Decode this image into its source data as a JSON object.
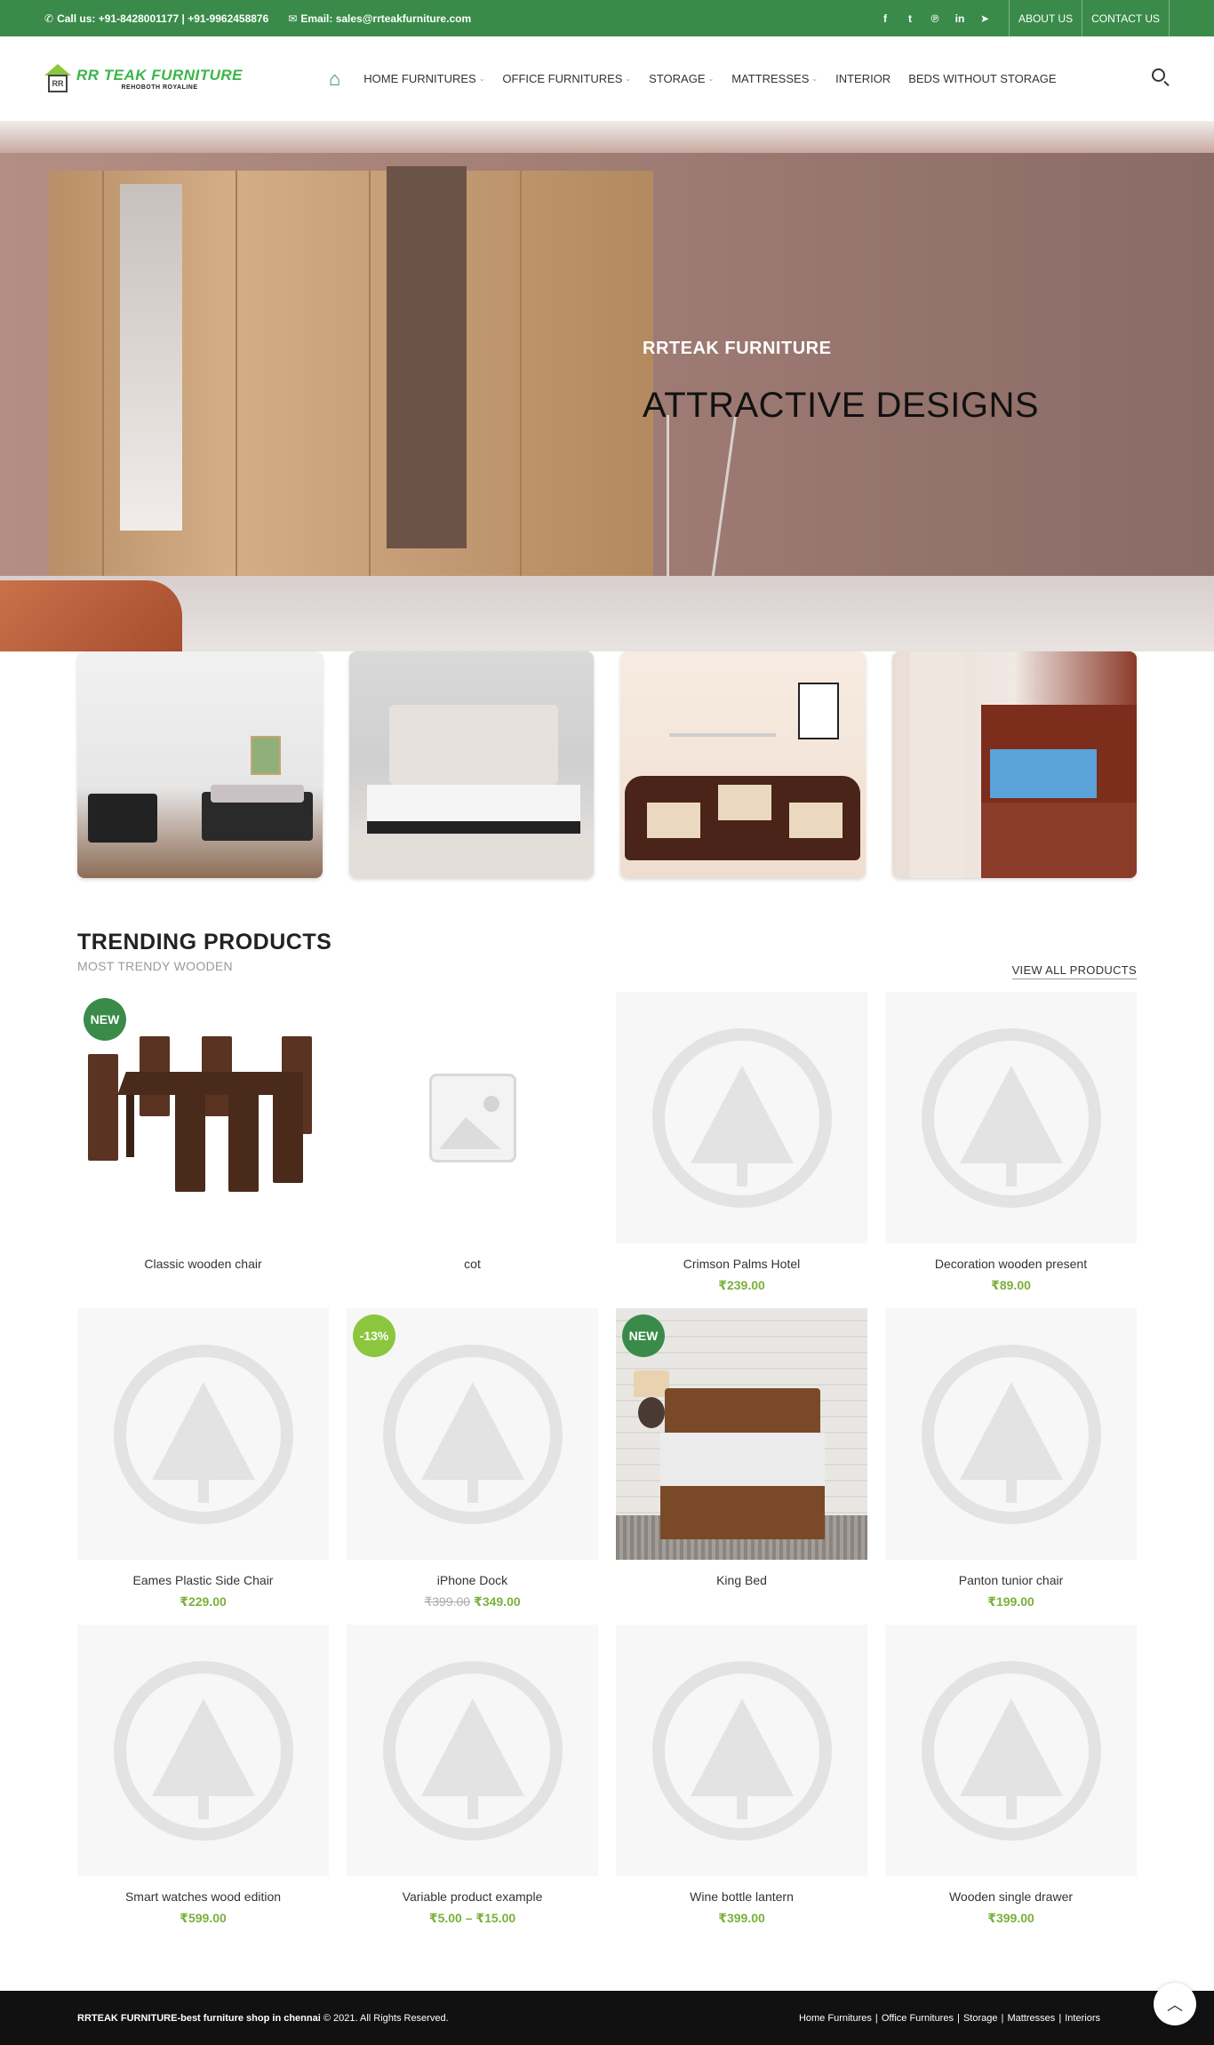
{
  "topbar": {
    "phone": "Call us: +91-8428001177 | +91-9962458876",
    "email": "Email: sales@rrteakfurniture.com",
    "social": [
      "facebook-icon",
      "twitter-icon",
      "pinterest-icon",
      "linkedin-icon",
      "telegram-icon"
    ],
    "links": [
      "ABOUT US",
      "CONTACT US"
    ]
  },
  "header": {
    "logo_title": "RR TEAK FURNITURE",
    "logo_tagline": "REHOBOTH ROYALINE",
    "logo_mark": "RR",
    "nav": [
      {
        "label": "HOME FURNITURES",
        "caret": "⌄"
      },
      {
        "label": "OFFICE FURNITURES",
        "caret": "⌄"
      },
      {
        "label": "STORAGE",
        "caret": "⌄"
      },
      {
        "label": "MATTRESSES",
        "caret": "⌄"
      },
      {
        "label": "INTERIOR",
        "caret": ""
      },
      {
        "label": "BEDS WITHOUT STORAGE",
        "caret": ""
      }
    ]
  },
  "hero": {
    "subtitle": "RRTEAK FURNITURE",
    "title": "ATTRACTIVE DESIGNS"
  },
  "trending": {
    "title": "TRENDING PRODUCTS",
    "subtitle": "MOST TRENDY WOODEN",
    "view_all": "VIEW ALL PRODUCTS",
    "products": [
      {
        "name": "Classic wooden chair",
        "price": "",
        "badge": "NEW"
      },
      {
        "name": "cot",
        "price": "",
        "badge": ""
      },
      {
        "name": "Crimson Palms Hotel",
        "price": "₹239.00",
        "badge": ""
      },
      {
        "name": "Decoration wooden present",
        "price": "₹89.00",
        "badge": ""
      },
      {
        "name": "Eames Plastic Side Chair",
        "price": "₹229.00",
        "badge": ""
      },
      {
        "name": "iPhone Dock",
        "old_price": "₹399.00",
        "price": "₹349.00",
        "badge": "-13%"
      },
      {
        "name": "King Bed",
        "price": "",
        "badge": "NEW"
      },
      {
        "name": "Panton tunior chair",
        "price": "₹199.00",
        "badge": ""
      },
      {
        "name": "Smart watches wood edition",
        "price": "₹599.00",
        "badge": ""
      },
      {
        "name": "Variable product example",
        "price": "₹5.00 – ₹15.00",
        "badge": ""
      },
      {
        "name": "Wine bottle lantern",
        "price": "₹399.00",
        "badge": ""
      },
      {
        "name": "Wooden single drawer",
        "price": "₹399.00",
        "badge": ""
      }
    ]
  },
  "footer": {
    "copyright_brand": "RRTEAK FURNITURE-best furniture shop in chennai",
    "copyright_rest": "© 2021. All Rights Reserved.",
    "links": [
      "Home Furnitures",
      "Office Furnitures",
      "Storage",
      "Mattresses",
      "Interiors"
    ]
  },
  "colors": {
    "brand_green": "#3a8b4a",
    "accent_green": "#8cc63f",
    "price_green": "#7ab03a"
  }
}
